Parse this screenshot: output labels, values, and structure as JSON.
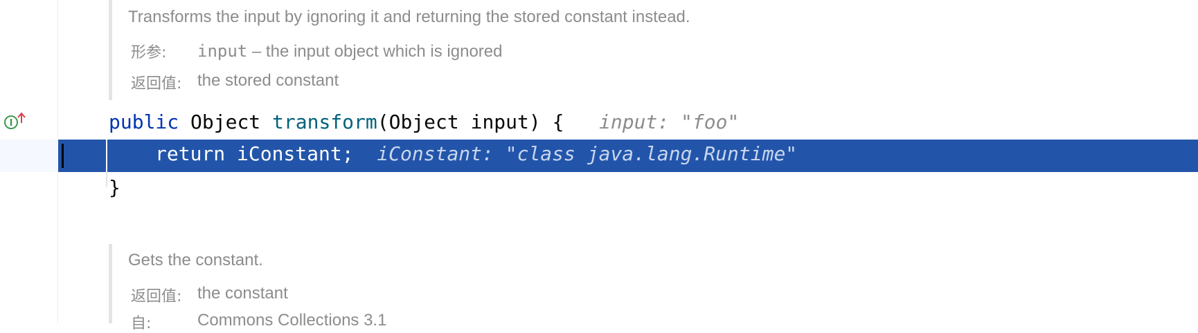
{
  "doc1": {
    "summary": "Transforms the input by ignoring it and returning the stored constant instead.",
    "params_label": "形参:",
    "param_name": "input",
    "param_desc": " – the input object which is ignored",
    "returns_label": "返回值:",
    "returns_desc": "the stored constant"
  },
  "code": {
    "line1": {
      "kw": "public",
      "type": " Object ",
      "fn": "transform",
      "rest": "(Object input) {",
      "hint": "input: \"foo\""
    },
    "line2": {
      "text": "return iConstant;",
      "hint": "iConstant: \"class java.lang.Runtime\""
    },
    "line3": "}"
  },
  "doc2": {
    "summary": "Gets the constant.",
    "returns_label": "返回值:",
    "returns_desc": "the constant",
    "since_label": "自:",
    "since_desc": "Commons Collections 3.1"
  },
  "gutter": {
    "icon": "implements-method-icon"
  },
  "colors": {
    "keyword": "#0033b3",
    "method": "#00627a",
    "hint": "#8c8c8c",
    "selection": "#2255aa"
  }
}
